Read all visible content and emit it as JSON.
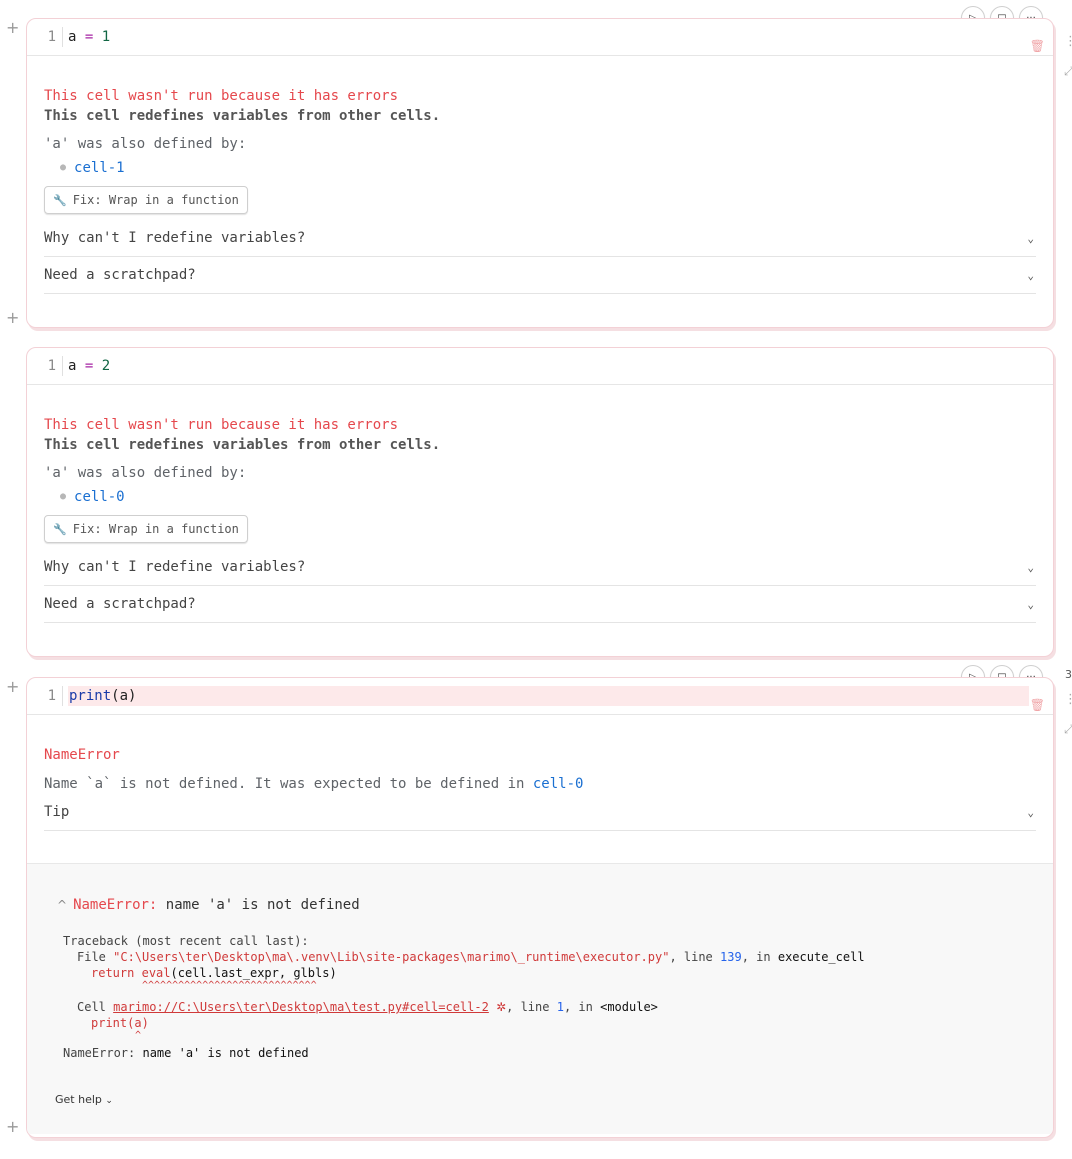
{
  "cells": [
    {
      "line_number": "1",
      "code": {
        "var": "a",
        "op": "=",
        "value": "1"
      },
      "error_title": "This cell wasn't run because it has errors",
      "error_subtitle": "This cell redefines variables from other cells.",
      "also_defined": "'a' was also defined by:",
      "defined_by": "cell-1",
      "fix_button": "Fix: Wrap in a function",
      "accordions": [
        "Why can't I redefine variables?",
        "Need a scratchpad?"
      ]
    },
    {
      "line_number": "1",
      "code": {
        "var": "a",
        "op": "=",
        "value": "2"
      },
      "error_title": "This cell wasn't run because it has errors",
      "error_subtitle": "This cell redefines variables from other cells.",
      "also_defined": "'a' was also defined by:",
      "defined_by": "cell-0",
      "fix_button": "Fix: Wrap in a function",
      "accordions": [
        "Why can't I redefine variables?",
        "Need a scratchpad?"
      ]
    }
  ],
  "cell3": {
    "line_number": "1",
    "code_fn": "print",
    "code_args": "(a)",
    "error_name": "NameError",
    "message_pre": "Name `a` is not defined. It was expected to be defined in",
    "message_link": "cell-0",
    "tip": "Tip",
    "side_number": "3",
    "traceback": {
      "header_name": "NameError:",
      "header_msg": "name 'a' is not defined",
      "line1": "Traceback (most recent call last):",
      "file_label": "File",
      "file_path": "\"C:\\Users\\ter\\Desktop\\ma\\.venv\\Lib\\site-packages\\marimo\\_runtime\\executor.py\"",
      "line_label": ", line",
      "line_no": "139",
      "in_label": ", in",
      "func": "execute_cell",
      "return_kw": "return",
      "return_call": "eval",
      "return_args": "(cell.last_expr, glbls)",
      "carets1": "^^^^^^^^^^^^^^^^^^^^^^^^^^^^^",
      "cell_label": "Cell",
      "cell_link": "marimo://C:\\Users\\ter\\Desktop\\ma\\test.py#cell=cell-2",
      "cell_line_label": ", line",
      "cell_line_no": "1",
      "cell_in_label": ", in",
      "cell_module": "<module>",
      "print_line": "print(a)",
      "carets2": "^",
      "final_name": "NameError:",
      "final_msg": "name 'a' is not defined"
    },
    "get_help": "Get help"
  },
  "icons": {
    "run": "run-icon",
    "stop": "stop-icon",
    "more": "more-icon",
    "delete": "trash-icon",
    "expand": "expand-icon",
    "drag": "drag-handle-icon",
    "add": "add-cell-icon",
    "wrench": "wrench-icon",
    "chevron": "chevron-down-icon",
    "bug": "bug-icon"
  },
  "colors": {
    "error": "#e5484d",
    "link": "#1a6fd1",
    "cell_border": "#f3d1d6"
  }
}
